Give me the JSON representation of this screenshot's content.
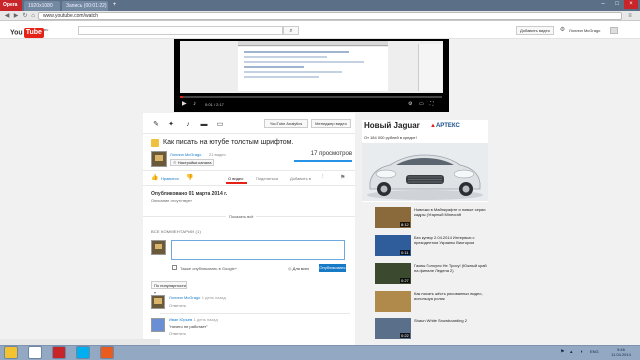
{
  "browser": {
    "name": "Opera",
    "tabs": [
      {
        "label": "1920x1080"
      },
      {
        "label": "Запись (00:01:22)"
      }
    ],
    "url": "www.youtube.com/watch"
  },
  "youtube_header": {
    "logo_text": "You",
    "logo_box": "Tube",
    "logo_region": "RU",
    "upload_label": "Добавить видео",
    "user_name": "Лоллип McGrago"
  },
  "player": {
    "time": "0:01 / 2:17",
    "progress_fraction": 0.01
  },
  "toolbar": {
    "analytics_label": "YouTube Analytics",
    "manager_label": "Менеджер видео"
  },
  "video": {
    "title": "Как писать на ютубе толстым шрифтом.",
    "author": "Лоллип McGrago",
    "video_count": "21 видео",
    "channel_settings_label": "Настройки канала",
    "views": "17 просмотров",
    "like_label": "Нравится",
    "tabs": [
      {
        "label": "О видео"
      },
      {
        "label": "Поделиться"
      },
      {
        "label": "Добавить в"
      }
    ],
    "published": "Опубликовано 01 марта 2014 г.",
    "description": "Описание отсутствует",
    "show_all": "Показать всё"
  },
  "comments": {
    "header": "ВСЕ КОММЕНТАРИИ (1)",
    "gplus_label": "Также опубликовать в Google+",
    "audience_label": "Для всех",
    "publish_label": "Опубликовать",
    "sort_label": "По популярности",
    "items": [
      {
        "author": "Лоллип McGrago",
        "time": "1 день назад",
        "reply_label": "Ответить",
        "text": ""
      },
      {
        "author": "Иван Юрьев",
        "time": "1 день назад",
        "text": "\"ничего не работает\"",
        "reply_label": "Ответить"
      }
    ]
  },
  "ad": {
    "title": "Новый Jaguar",
    "brand": "АРТЕКС",
    "subtitle": "От 184 000 рублей в кредит!"
  },
  "suggestions": [
    {
      "title": "Новички в Майнкрафте и новые серии кадры (Угарный Minecraft",
      "meta": "",
      "duration": "8:12"
    },
    {
      "title": "Без купюр 2.04.2014 Интервью с президентом Украины Виктором",
      "meta": "",
      "duration": "0:11"
    },
    {
      "title": "Гаовы Голоуля Не Тросу! (Южный край на финале Ледена 2)",
      "meta": "",
      "duration": "0:27"
    },
    {
      "title": "Как писать жёсть рисованных видео, используя ролик",
      "meta": "",
      "duration": ""
    },
    {
      "title": "Shaun White Snowboarding 2",
      "meta": "",
      "duration": "0:22"
    }
  ],
  "taskbar": {
    "lang": "ENG",
    "time": "9:46",
    "date": "11.04.2014",
    "apps": [
      {
        "name": "explorer-icon",
        "color": "#f2c230"
      },
      {
        "name": "yandex-browser-icon",
        "color": "#ffffff"
      },
      {
        "name": "opera-icon",
        "color": "#c8252b"
      },
      {
        "name": "skype-icon",
        "color": "#00aff0"
      },
      {
        "name": "media-player-icon",
        "color": "#e85d1f"
      }
    ]
  },
  "colors": {
    "youtube_red": "#e62117",
    "link_blue": "#167ac6",
    "taskbar": "#93a8c2"
  }
}
